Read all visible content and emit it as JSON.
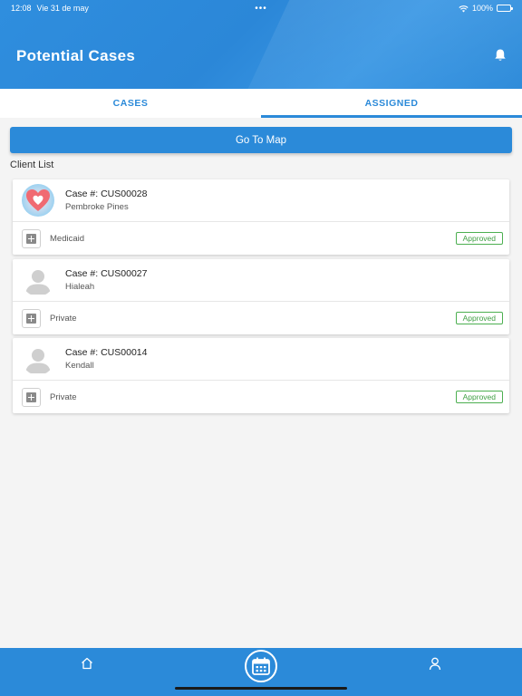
{
  "status_bar": {
    "time": "12:08",
    "date": "Vie 31 de may",
    "dots": "•••",
    "battery": "100%"
  },
  "header": {
    "title": "Potential Cases"
  },
  "tabs": [
    {
      "label": "CASES",
      "active": false
    },
    {
      "label": "ASSIGNED",
      "active": true
    }
  ],
  "map_button": {
    "label": "Go To Map"
  },
  "client_list": {
    "title": "Client List",
    "items": [
      {
        "case_label": "Case #: CUS00028",
        "city": "Pembroke Pines",
        "insurance": "Medicaid",
        "status": "Approved",
        "avatar": "heart-photo"
      },
      {
        "case_label": "Case #: CUS00027",
        "city": "Hialeah",
        "insurance": "Private",
        "status": "Approved",
        "avatar": "default-avatar"
      },
      {
        "case_label": "Case #: CUS00014",
        "city": "Kendall",
        "insurance": "Private",
        "status": "Approved",
        "avatar": "default-avatar"
      }
    ]
  },
  "bottom_nav": {
    "items": [
      "home-icon",
      "calendar-icon",
      "profile-icon"
    ]
  },
  "colors": {
    "primary": "#2b8ad9",
    "approved": "#4caf50",
    "background": "#f4f4f4"
  }
}
